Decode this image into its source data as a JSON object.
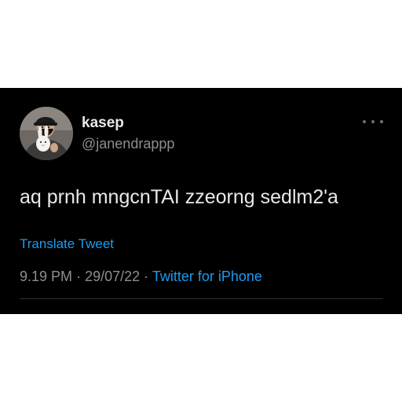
{
  "tweet": {
    "author": {
      "display_name": "kasep",
      "handle": "@janendrappp",
      "avatar": "avatar-photo"
    },
    "more_icon": "more-horizontal-icon",
    "text": "aq prnh mngcnTAI zzeorng sedlm2'a",
    "translate_label": "Translate Tweet",
    "time": "9.19 PM",
    "separator": "·",
    "date": "29/07/22",
    "source": "Twitter for iPhone"
  },
  "colors": {
    "background": "#000000",
    "text": "#e7e9ea",
    "secondary": "#8b8f93",
    "accent": "#1d9bf0"
  }
}
